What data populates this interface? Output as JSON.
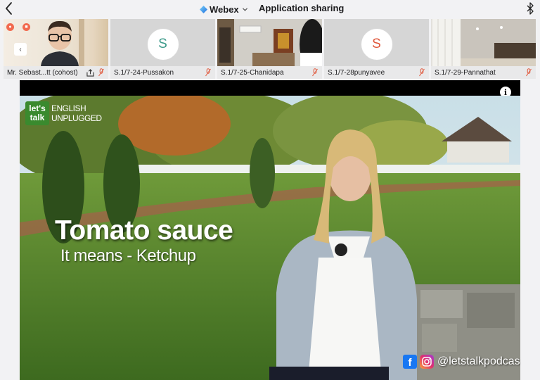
{
  "app": {
    "name": "Webex",
    "mode": "Application sharing"
  },
  "participants": [
    {
      "name": "Mr. Sebast...tt (cohost)",
      "type": "video"
    },
    {
      "name": "S.1/7-24-Pussakon",
      "type": "avatar",
      "initial": "S",
      "initial_color": "#3c9a8a"
    },
    {
      "name": "S.1/7-25-Chanidapa",
      "type": "video"
    },
    {
      "name": "S.1/7-28punyavee",
      "type": "avatar",
      "initial": "S",
      "initial_color": "#e0573b"
    },
    {
      "name": "S.1/7-29-Pannathat",
      "type": "video"
    }
  ],
  "shared_video": {
    "brand_badge": "let's talk",
    "brand_text_line1": "ENGLISH",
    "brand_text_line2": "UNPLUGGED",
    "caption_main": "Tomato sauce",
    "caption_sub": "It means - Ketchup",
    "social_handle": "@letstalkpodcast",
    "info_label": "i"
  },
  "icons": {
    "back": "chevron-left-icon",
    "webex_logo": "webex-logo-icon",
    "dropdown": "chevron-down-icon",
    "bluetooth": "bluetooth-icon",
    "mic_muted": "mic-muted-icon",
    "share": "share-icon"
  },
  "colors": {
    "accent_blue": "#1f8ef1",
    "muted_red": "#e0573b",
    "rec_orange": "#f26a4f"
  }
}
